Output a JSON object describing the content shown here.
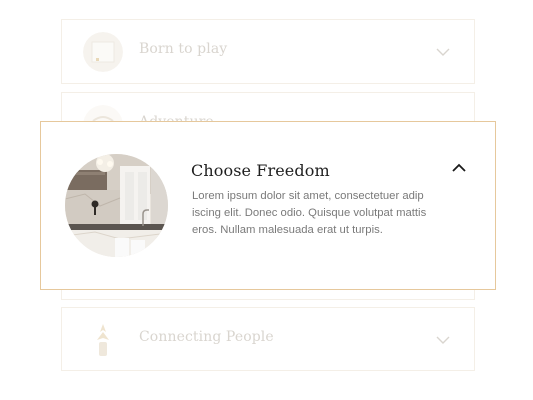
{
  "accordion": {
    "items": [
      {
        "title": "Born to play",
        "expanded": false,
        "icon": "chevron-down-icon"
      },
      {
        "title": "Adventure",
        "expanded": false,
        "icon": "chevron-down-icon"
      },
      {
        "title": "Choose Freedom",
        "expanded": true,
        "body": "Lorem ipsum dolor sit amet, consectetuer adip iscing elit. Donec odio. Quisque volutpat mattis eros. Nullam malesuada erat ut turpis.",
        "icon": "chevron-up-icon"
      },
      {
        "title": "Connecting People",
        "expanded": false,
        "icon": "chevron-down-icon"
      }
    ]
  },
  "colors": {
    "accent_border": "#e6c89c",
    "faded_border": "#f4efe7",
    "title_dark": "#1f1f1f",
    "body_text": "#7a7a7a",
    "faded_text": "#d9d5cf"
  }
}
